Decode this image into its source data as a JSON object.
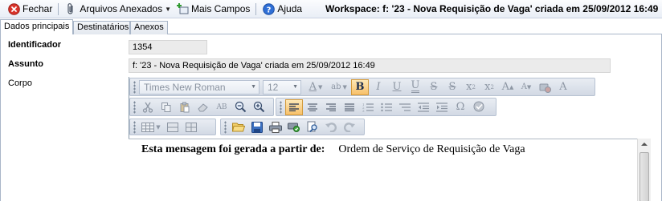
{
  "toolbar": {
    "close_label": "Fechar",
    "attachments_label": "Arquivos Anexados",
    "more_fields_label": "Mais Campos",
    "help_label": "Ajuda"
  },
  "workspace_title": "Workspace: f: '23 - Nova Requisição de Vaga' criada em 25/09/2012 16:49",
  "tabs": [
    {
      "label": "Dados principais",
      "active": true
    },
    {
      "label": "Destinatários",
      "active": false
    },
    {
      "label": "Anexos",
      "active": false
    }
  ],
  "form": {
    "identifier_label": "Identificador",
    "identifier_value": "1354",
    "subject_label": "Assunto",
    "subject_value": "f: '23 - Nova Requisição de Vaga' criada em 25/09/2012 16:49",
    "body_label": "Corpo"
  },
  "editor": {
    "font_family": "Times New Roman",
    "font_size": "12",
    "active_align": "left",
    "bold_active": true,
    "content_bold": "Esta mensagem foi gerada a partir de:",
    "content_text": "Ordem de Serviço de Requisição de Vaga"
  },
  "colors": {
    "toolbar_bg": "#e9eef6",
    "field_bg": "#ebebeb",
    "strip_bg": "#d2d9e4",
    "active_button": "#f7c06a"
  }
}
